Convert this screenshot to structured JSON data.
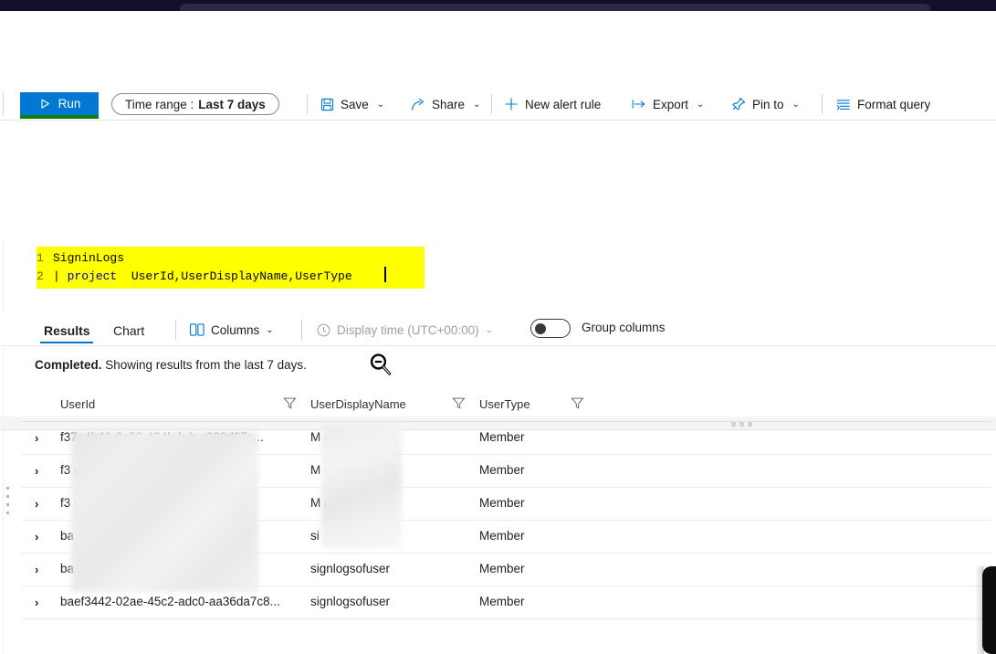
{
  "window": {
    "chrome_color": "#14102b",
    "tab_color": "#2c2745"
  },
  "command_bar": {
    "run": {
      "label": "Run",
      "icon": "play-icon",
      "bg": "#0078d4",
      "underline": "#107c10"
    },
    "time_range": {
      "label": "Time range :",
      "value": "Last 7 days"
    },
    "save": {
      "label": "Save",
      "icon": "save-icon",
      "chevron": "⌄"
    },
    "share": {
      "label": "Share",
      "icon": "share-icon",
      "chevron": "⌄"
    },
    "new_alert_rule": {
      "label": "New alert rule",
      "icon": "plus-icon"
    },
    "export": {
      "label": "Export",
      "icon": "export-icon",
      "chevron": "⌄"
    },
    "pin_to": {
      "label": "Pin to",
      "icon": "pin-icon",
      "chevron": "⌄"
    },
    "format_query": {
      "label": "Format query",
      "icon": "format-icon"
    }
  },
  "editor": {
    "highlight_color": "#ffff00",
    "lines": [
      {
        "number": "1",
        "indent": "",
        "keyword": "",
        "text": "SigninLogs"
      },
      {
        "number": "2",
        "indent": "| ",
        "keyword": "project",
        "text": "  UserId,UserDisplayName,UserType"
      }
    ],
    "cursor": "text-caret"
  },
  "results": {
    "tabs": [
      {
        "label": "Results",
        "selected": true
      },
      {
        "label": "Chart",
        "selected": false
      }
    ],
    "columns_button": {
      "label": "Columns",
      "icon": "columns-icon",
      "chevron": "⌄"
    },
    "display_time_button": {
      "label": "Display time (UTC+00:00)",
      "icon": "clock-icon",
      "chevron": "⌄",
      "disabled": true
    },
    "group_columns_toggle": {
      "label": "Group columns",
      "state": "off"
    },
    "status": {
      "prefix": "Completed.",
      "text": " Showing results from the last 7 days."
    },
    "cursor": "zoom-out-magnifier",
    "accent_color": "#0078d4"
  },
  "table": {
    "columns": [
      {
        "name": "UserId",
        "filter_icon": "filter-icon"
      },
      {
        "name": "UserDisplayName",
        "filter_icon": "filter-icon"
      },
      {
        "name": "UserType",
        "filter_icon": "filter-icon"
      }
    ],
    "expand_icon": "chevron-right-icon",
    "rows": [
      {
        "user_id": "f37a4b41-8c80-424b-b-b-c980d07c...",
        "user_display_name": "M            reem",
        "user_type": "Member"
      },
      {
        "user_id": "f3                          d07c...",
        "user_display_name": "M            reem",
        "user_type": "Member"
      },
      {
        "user_id": "f3                          d07c...",
        "user_display_name": "M            reem",
        "user_type": "Member"
      },
      {
        "user_id": "ba                          a7c8...",
        "user_display_name": "si",
        "user_type": "Member"
      },
      {
        "user_id": "ba                          a7c8...",
        "user_display_name": "signlogsofuser",
        "user_type": "Member"
      },
      {
        "user_id": "baef3442-02ae-45c2-adc0-aa36da7c8...",
        "user_display_name": "signlogsofuser",
        "user_type": "Member"
      }
    ]
  }
}
